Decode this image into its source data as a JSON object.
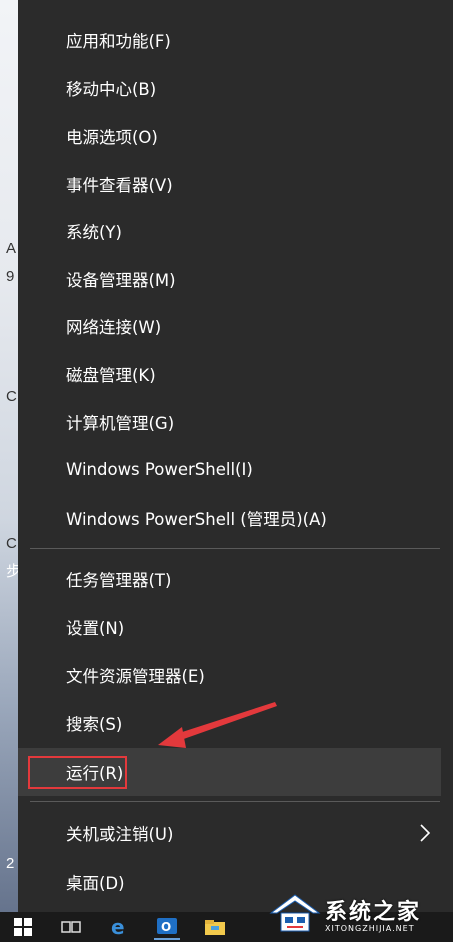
{
  "menu": {
    "items": [
      {
        "label": "应用和功能(F)"
      },
      {
        "label": "移动中心(B)"
      },
      {
        "label": "电源选项(O)"
      },
      {
        "label": "事件查看器(V)"
      },
      {
        "label": "系统(Y)"
      },
      {
        "label": "设备管理器(M)"
      },
      {
        "label": "网络连接(W)"
      },
      {
        "label": "磁盘管理(K)"
      },
      {
        "label": "计算机管理(G)"
      },
      {
        "label": "Windows PowerShell(I)"
      },
      {
        "label": "Windows PowerShell (管理员)(A)"
      },
      {
        "label": "任务管理器(T)"
      },
      {
        "label": "设置(N)"
      },
      {
        "label": "文件资源管理器(E)"
      },
      {
        "label": "搜索(S)"
      },
      {
        "label": "运行(R)"
      },
      {
        "label": "关机或注销(U)"
      },
      {
        "label": "桌面(D)"
      }
    ],
    "highlighted_item": "运行(R)"
  },
  "desktop_fragments": [
    "A",
    "9",
    "C",
    "C",
    "步",
    "2"
  ],
  "watermark": {
    "name_cn": "系统之家",
    "site": "XITONGZHIJIA.NET"
  },
  "taskbar": {
    "icons": [
      "windows-start-icon",
      "task-view-icon",
      "edge-icon",
      "outlook-icon",
      "file-explorer-icon"
    ]
  },
  "colors": {
    "menu_bg": "#2b2b2b",
    "highlight_bg": "#3d3d3d",
    "annotation_red": "#e3393c",
    "text": "#ffffff"
  }
}
